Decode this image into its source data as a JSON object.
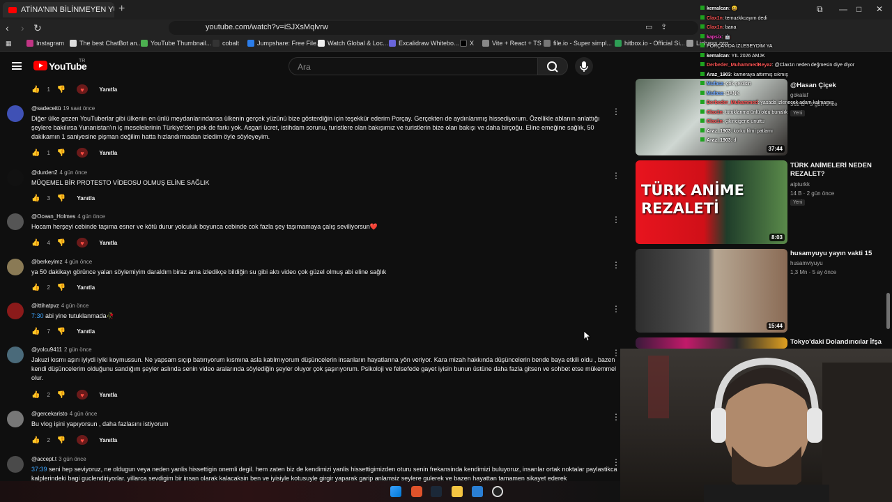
{
  "browser": {
    "tab_title": "ATİNA'NIN BİLİNMEYEN YÜZÜ (K",
    "url": "youtube.com/watch?v=iSJXsMqlvrw",
    "bookmarks": [
      "Instagram",
      "The best ChatBot an...",
      "YouTube Thumbnail...",
      "cobalt",
      "Jumpshare: Free File...",
      "Watch Global & Loc...",
      "Excalidraw Whitebo...",
      "X",
      "Vite + React + TS",
      "file.io - Super simpl...",
      "hitbox.io - Official Si...",
      "Lichess.org"
    ]
  },
  "youtube": {
    "logo_text": "YouTube",
    "logo_sup": "TR",
    "search_placeholder": "Ara",
    "reply_label": "Yanıtla"
  },
  "top_action": {
    "likes": "1"
  },
  "comments": [
    {
      "author": "@sadeceitü",
      "time": "19 saat önce",
      "text": "Diğer ülke gezen YouTuberlar gibi ülkenin en ünlü meydanlarındansa ülkenin gerçek yüzünü bize gösterdiğin için teşekkür ederim Porçay. Gerçekten de aydınlanmış hissediyorum. Özellikle ablanın anlattığı şeylere bakılırsa Yunanistan'ın iç meselelerinin Türkiye'den pek de farkı yok. Asgari ücret, istihdam sorunu, turistlere olan bakışımız ve turistlerin bize olan bakışı ve daha birçoğu. Eline emeğine sağlık, 50 dakikamın 1 saniyesine pişman değilim hatta hızlandırmadan izledim öyle söyleyeyim.",
      "likes": "1",
      "heart": true,
      "avatar_color": "#3f51b5"
    },
    {
      "author": "@durden2",
      "time": "4 gün önce",
      "text": "MÜQEMEL BİR PROTESTO VİDEOSU OLMUŞ ELİNE SAĞLIK",
      "likes": "3",
      "heart": false,
      "avatar_color": "#111111"
    },
    {
      "author": "@Ocean_Holmes",
      "time": "4 gün önce",
      "text": "Hocam herşeyi cebinde taşıma esner ve kötü durur yolculuk boyunca cebinde cok fazla şey taşımamaya çalış seviliyorsun❤️",
      "likes": "4",
      "heart": true,
      "avatar_color": "#555555"
    },
    {
      "author": "@berkeyimz",
      "time": "4 gün önce",
      "text": "ya 50 dakikayı görünce yalan söylemiyim daraldım biraz ama izledikçe bildiğin su gibi aktı video çok güzel olmuş abi eline sağlık",
      "likes": "2",
      "heart": false,
      "avatar_color": "#8a7a55"
    },
    {
      "author": "@ittihatpvz",
      "time": "4 gün önce",
      "timestamp": "7:30",
      "text": " abi yine tutuklanmada🥀",
      "likes": "7",
      "heart": false,
      "avatar_color": "#8b1a1a"
    },
    {
      "author": "@yolcu9411",
      "time": "2 gün önce",
      "text": "Jakuzi kısmı aşırı iyiydi iyiki koymussun. Ne yapsam sıçıp batırıyorum kısmına asla katılmıyorum düşüncelerin insanların hayatlarına yön veriyor. Kara mizah hakkında düşüncelerin bende baya etkili oldu , bazen kendi düşüncelerim olduğunu sandığım şeyler aslında senin video aralarında söylediğin şeyler oluyor çok şaşırıyorum. Psikoloji ve felsefede gayet iyisin bunun üstüne daha fazla gitsen ve sohbet etse mükemmel olur.",
      "likes": "2",
      "heart": true,
      "avatar_color": "#4a6a7a"
    },
    {
      "author": "@gercekaristo",
      "time": "4 gün önce",
      "text": "Bu vlog işini yapıyorsun , daha fazlasını istiyorum",
      "likes": "2",
      "heart": true,
      "avatar_color": "#777777"
    },
    {
      "author": "@accept.t",
      "time": "3 gün önce",
      "timestamp": "37:39",
      "text": " seni hep seviyoruz, ne oldugun veya neden yanlis hissettigin onemli degil. hem zaten biz de kendimizi yanlis hissettigimizden oturu senin frekansinda kendimizi buluyoruz, insanlar ortak noktalar paylastikca kalplerindeki bagi guclendiriyorlar. yillarca sevdigim bir insan olarak kalacaksin ben ve iyisiyle kotusuyle girgir yaparak garip anlamsiz seylere gulerek ve bazen hayattan tamamen sikayet ederek",
      "likes": "",
      "heart": false,
      "avatar_color": "#4a4a4a"
    }
  ],
  "sidebar": [
    {
      "title": "@Hasan Çiçek",
      "channel": "gokalaf",
      "meta": "362 B · 3 gün önce",
      "badge": "Yeni",
      "duration": "37:44"
    },
    {
      "title": "TÜRK ANİMELERİ NEDEN REZALET?",
      "channel": "alpturkk",
      "meta": "14 B · 2 gün önce",
      "badge": "Yeni",
      "duration": "8:03",
      "thumb_text": [
        "TÜRK ANİME",
        "REZALETİ"
      ]
    },
    {
      "title": "husamyuyu yayın vakti 15",
      "channel": "husamviyuyu",
      "meta": "1,3 Mn · 5 ay önce",
      "duration": "15:44"
    },
    {
      "title": "Tokyo'daki Dolandırıcılar İfşa",
      "channel": "",
      "meta": ""
    }
  ],
  "chat": [
    {
      "user": "kemalcan",
      "msg": ": 😀",
      "color": "#ffffff"
    },
    {
      "user": "Clax1n",
      "msg": ": temuzkkcayım dedi",
      "color": "#ff5555"
    },
    {
      "user": "Clax1n",
      "msg": ": bana",
      "color": "#ff5555"
    },
    {
      "user": "kapsix",
      "msg": ": 🤖",
      "color": "#ff44cc"
    },
    {
      "user": "",
      "msg": "PORÇAY DA İZLESEYDİM YA",
      "color": "#ffffff"
    },
    {
      "user": "kemalcan",
      "msg": ": YIL 2026 AMJK",
      "color": "#ffffff"
    },
    {
      "user": "Derbeder_MuhammedBeyaz",
      "msg": ": @Clax1n neden değmesin diye diyor",
      "color": "#ff5555"
    },
    {
      "user": "Araz_1903",
      "msg": ": kameraya attırmış sıkmış",
      "color": "#ffffff"
    },
    {
      "user": "Mufasa",
      "msg": ": çok şekilsin",
      "color": "#6fa8ff"
    },
    {
      "user": "Mufasa",
      "msg": ": BANK",
      "color": "#6fa8ff"
    },
    {
      "user": "Derbeder_Muhammed",
      "msg": ": yasada izlenecek adam kalmamış",
      "color": "#ff5555"
    },
    {
      "user": "Clax1n",
      "msg": ": tutuklanma ünlü oldu bunalık",
      "color": "#ff5555"
    },
    {
      "user": "Clax1n",
      "msg": ": çikincigene unuttu",
      "color": "#ff5555"
    },
    {
      "user": "Araz_1903",
      "msg": ": korku filmi patlamı",
      "color": "#ffffff"
    },
    {
      "user": "Araz_1903",
      "msg": ": d",
      "color": "#ffffff"
    }
  ]
}
